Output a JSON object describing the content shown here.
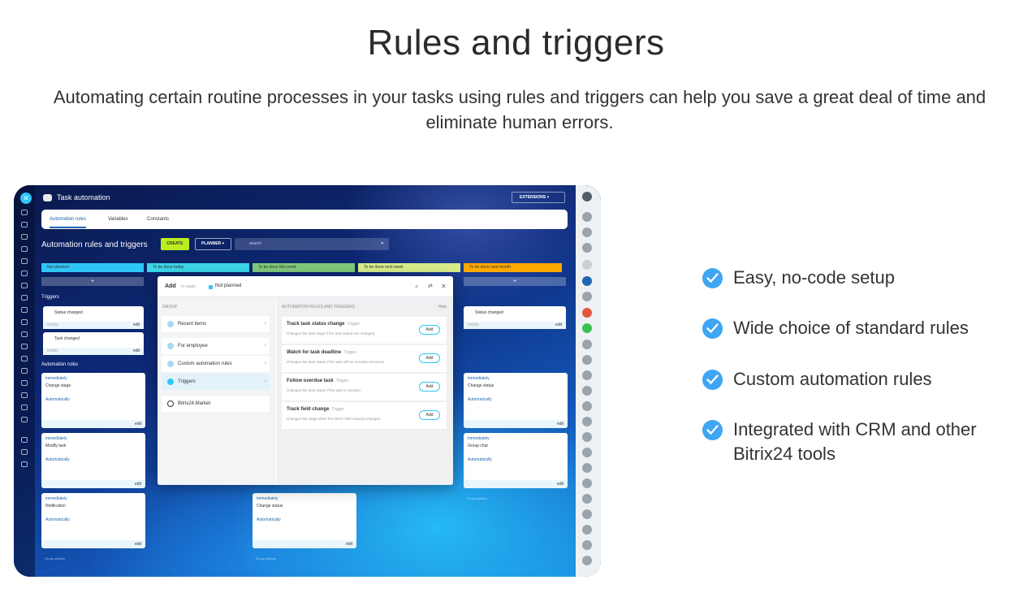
{
  "hero": {
    "title": "Rules and triggers",
    "subtitle": "Automating certain routine processes in your tasks using rules and triggers can help you save a great deal of time and eliminate human errors."
  },
  "app": {
    "title": "Task automation",
    "extensions": "EXTENSIONS",
    "tabs": [
      "Automation rules",
      "Variables",
      "Constants"
    ],
    "heading": "Automation rules and triggers",
    "create": "CREATE",
    "planner": "PLANNER",
    "search_placeholder": "search",
    "stages": [
      {
        "label": "Not planned",
        "color": "#2fc6f6"
      },
      {
        "label": "To be done today",
        "color": "#3bd6e8"
      },
      {
        "label": "To be done this week",
        "color": "#7fc97c"
      },
      {
        "label": "To be done next week",
        "color": "#d8ec8a"
      },
      {
        "label": "To be done next month",
        "color": "#ffa900"
      }
    ],
    "triggers_label": "Triggers",
    "automation_rules_label": "Automation rules",
    "trigger_cards": [
      "Status changed",
      "Task changed",
      "Status changed"
    ],
    "empty": "empty",
    "edit": "edit",
    "group_actions": "Group actions",
    "rule_cards": [
      {
        "when": "immediately",
        "name": "Change stage",
        "to": "Automatically"
      },
      {
        "when": "immediately",
        "name": "Modify task",
        "to": "Automatically"
      },
      {
        "when": "immediately",
        "name": "Notification",
        "to": "Automatically"
      },
      {
        "when": "immediately",
        "name": "Change status",
        "to": "Automatically"
      },
      {
        "when": "immediately",
        "name": "Change status",
        "to": "Automatically"
      },
      {
        "when": "immediately",
        "name": "Group chat",
        "to": "Automatically"
      }
    ]
  },
  "popup": {
    "add": "Add",
    "to_stage": "to stage",
    "stage": "Not planned",
    "group_header": "GROUP",
    "right_header": "AUTOMATION RULES AND TRIGGERS",
    "help": "Help",
    "groups": [
      "Recent items",
      "For employee",
      "Custom automation rules",
      "Triggers",
      "Bitrix24.Market"
    ],
    "trigger_tag": "Trigger",
    "add_button": "Add",
    "rules": [
      {
        "title": "Track task status change",
        "desc": "Changes the task stage if the task status has changed."
      },
      {
        "title": "Watch for task deadline",
        "desc": "Changes the task status if the task will be overdue tomorrow."
      },
      {
        "title": "Follow overdue task",
        "desc": "Changes the task status if the task is overdue."
      },
      {
        "title": "Track field change",
        "desc": "Changes the stage when the item's field value(s) changes."
      }
    ]
  },
  "features": [
    "Easy, no-code setup",
    "Wide choice of standard rules",
    "Custom automation rules",
    "Integrated with CRM and other Bitrix24 tools"
  ],
  "colors": {
    "accent": "#3ea6f3",
    "create": "#bbed21",
    "link": "#2067b0"
  }
}
